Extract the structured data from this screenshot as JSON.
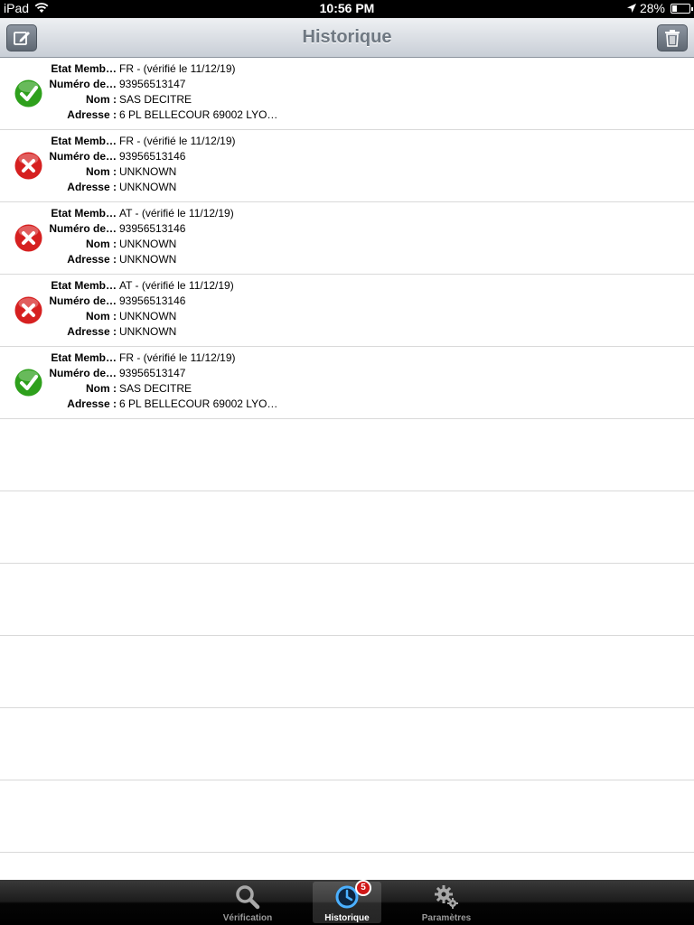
{
  "status_bar": {
    "device": "iPad",
    "time": "10:56 PM",
    "battery": "28%",
    "battery_level": 0.28
  },
  "navbar": {
    "title": "Historique",
    "edit_icon": "compose-icon",
    "trash_icon": "trash-icon"
  },
  "labels": {
    "etat": "Etat Memb…",
    "numero": "Numéro de…",
    "nom": "Nom :",
    "adresse": "Adresse :"
  },
  "entries": [
    {
      "status": "valid",
      "etat": "FR - (vérifié le 11/12/19)",
      "numero": "93956513147",
      "nom": "SAS DECITRE",
      "adresse": "6 PL BELLECOUR 69002 LYO…"
    },
    {
      "status": "invalid",
      "etat": "FR - (vérifié le 11/12/19)",
      "numero": "93956513146",
      "nom": "UNKNOWN",
      "adresse": "UNKNOWN"
    },
    {
      "status": "invalid",
      "etat": "AT - (vérifié le 11/12/19)",
      "numero": "93956513146",
      "nom": "UNKNOWN",
      "adresse": "UNKNOWN"
    },
    {
      "status": "invalid",
      "etat": "AT - (vérifié le 11/12/19)",
      "numero": "93956513146",
      "nom": "UNKNOWN",
      "adresse": "UNKNOWN"
    },
    {
      "status": "valid",
      "etat": "FR - (vérifié le 11/12/19)",
      "numero": "93956513147",
      "nom": "SAS DECITRE",
      "adresse": "6 PL BELLECOUR 69002 LYO…"
    }
  ],
  "tabbar": {
    "tabs": [
      {
        "label": "Vérification",
        "icon": "search-icon"
      },
      {
        "label": "Historique",
        "icon": "clock-icon",
        "badge": "5",
        "active": true
      },
      {
        "label": "Paramètres",
        "icon": "gear-icon"
      }
    ]
  },
  "colors": {
    "valid": "#2ea01c",
    "invalid": "#d62020",
    "badge": "#d01818"
  }
}
